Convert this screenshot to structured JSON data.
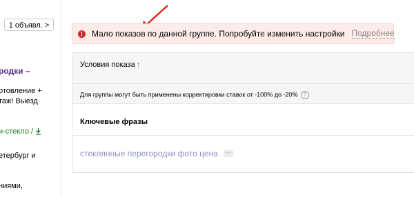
{
  "sidebar": {
    "ad_count_button": "1 объявл.",
    "ad_count_chevron": ">",
    "ad_title": "родки –",
    "ad_text_line1": "отовление +",
    "ad_text_line2": "таж! Выезд",
    "ad_domain": "и-стекло /",
    "ad_region_line1": "етербург и",
    "ad_more": "ниями,"
  },
  "warning": {
    "icon": "exclamation-icon",
    "text": "Мало показов по данной группе. Попробуйте изменить настройки",
    "link": "Подробнее",
    "color": "#fdebe9",
    "icon_color": "#d0282b"
  },
  "table": {
    "conditions_label": "Условия показа",
    "sort_arrow": "↑",
    "note": "Для группы могут быть применены корректировки ставок от -100% до -20%",
    "help_icon": "?",
    "keywords_title": "Ключевые фразы",
    "phrase": "стеклянные перегородки фото цена",
    "phrase_more": "···"
  }
}
